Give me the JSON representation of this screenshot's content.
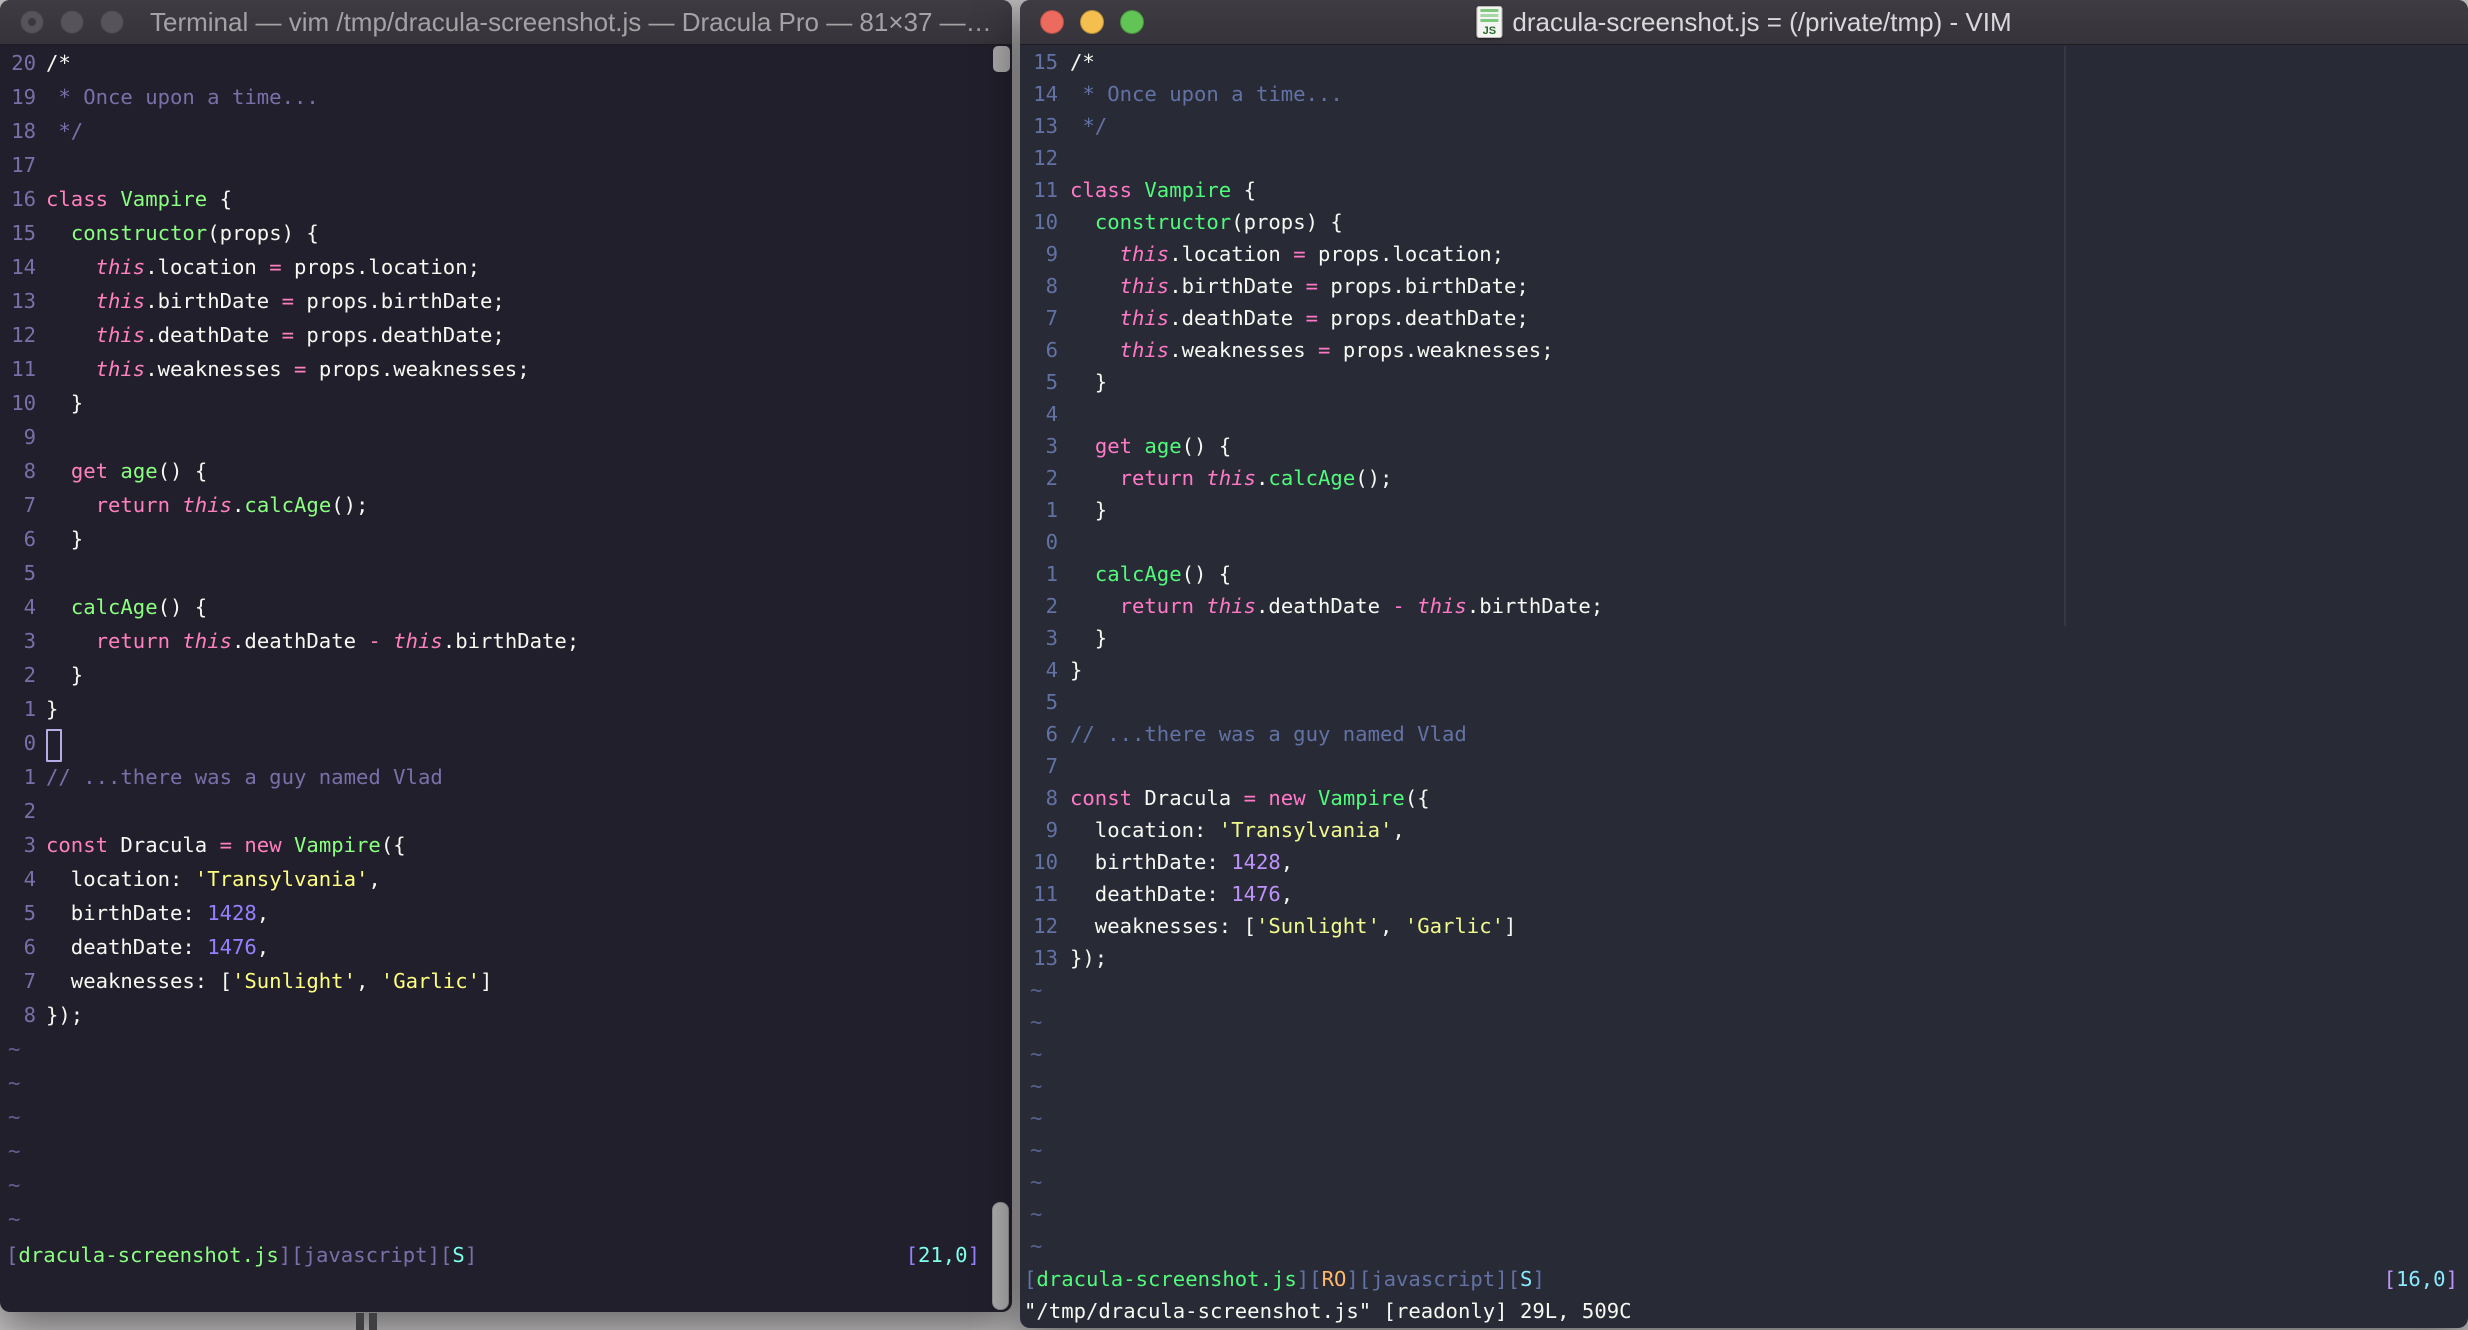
{
  "desktop": {
    "background": "#c6c4c5",
    "behind_window_fragment": "dark glyph fragment"
  },
  "left_window": {
    "app": "Terminal",
    "title": "Terminal — vim /tmp/dracula-screenshot.js — Dracula Pro — 81×37 —…",
    "focused": false,
    "traffic_lights": {
      "inactive_color": "#56535a",
      "close_has_edit_dot": true
    },
    "theme": {
      "bg": "#211f2b",
      "fg": "#f8f8f2",
      "comment": "#7970a9",
      "pink": "#ff80bf",
      "green": "#8aff80",
      "purple": "#9580ff",
      "yellow": "#ffff80",
      "cyan": "#80ffea",
      "orange": "#ffca80",
      "lineno": "#7970a9"
    },
    "rel_numbers": [
      "20",
      "19",
      "18",
      "17",
      "16",
      "15",
      "14",
      "13",
      "12",
      "11",
      "10",
      "9",
      "8",
      "7",
      "6",
      "5",
      "4",
      "3",
      "2",
      "1",
      "0",
      "1",
      "2",
      "3",
      "4",
      "5",
      "6",
      "7",
      "8"
    ],
    "tilde_rows": 6,
    "cursor": {
      "line": 21,
      "col": 0,
      "style": "hollow-block"
    },
    "status": {
      "segments": [
        [
          "comment",
          "["
        ],
        [
          "green",
          "dracula-screenshot.js"
        ],
        [
          "comment",
          "]["
        ],
        [
          "comment",
          "javascript"
        ],
        [
          "comment",
          "]["
        ],
        [
          "cyan",
          "S"
        ],
        [
          "comment",
          "]"
        ]
      ],
      "ruler": [
        [
          "purple",
          "["
        ],
        [
          "cyan",
          "21,0"
        ],
        [
          "purple",
          "]"
        ]
      ]
    },
    "scrollbar": {
      "top_thumb": true,
      "bottom_thumb": true,
      "color": "#a9a7a8"
    }
  },
  "right_window": {
    "app": "MacVim",
    "title": "dracula-screenshot.js = (/private/tmp) - VIM",
    "focused": true,
    "traffic_lights": {
      "close": "#ec6a5e",
      "minimize": "#f5bf4f",
      "zoom": "#61c454"
    },
    "file_icon": "js-document-icon",
    "theme": {
      "bg": "#282a36",
      "fg": "#f8f8f2",
      "comment": "#6272a4",
      "pink": "#ff79c6",
      "green": "#50fa7b",
      "purple": "#bd93f9",
      "yellow": "#f1fa8c",
      "cyan": "#8be9fd",
      "orange": "#ffb86c",
      "lineno": "#6272a4"
    },
    "rel_numbers": [
      "15",
      "14",
      "13",
      "12",
      "11",
      "10",
      "9",
      "8",
      "7",
      "6",
      "5",
      "4",
      "3",
      "2",
      "1",
      "0",
      "1",
      "2",
      "3",
      "4",
      "5",
      "6",
      "7",
      "8",
      "9",
      "10",
      "11",
      "12",
      "13"
    ],
    "tilde_rows": 9,
    "cursor": {
      "line": 16,
      "col": 0,
      "style": "hidden-blink"
    },
    "color_column": 80,
    "status": {
      "segments": [
        [
          "comment",
          "["
        ],
        [
          "green",
          "dracula-screenshot.js"
        ],
        [
          "comment",
          "]["
        ],
        [
          "orange",
          "RO"
        ],
        [
          "comment",
          "]["
        ],
        [
          "comment",
          "javascript"
        ],
        [
          "comment",
          "]["
        ],
        [
          "cyan",
          "S"
        ],
        [
          "comment",
          "]"
        ]
      ],
      "ruler": [
        [
          "purple",
          "["
        ],
        [
          "cyan",
          "16,0"
        ],
        [
          "purple",
          "]"
        ]
      ]
    },
    "message": "\"/tmp/dracula-screenshot.js\" [readonly] 29L, 509C"
  },
  "code_lines": [
    {
      "segments": [
        [
          "fg",
          "/*"
        ]
      ]
    },
    {
      "segments": [
        [
          "comment",
          " * Once upon a time..."
        ]
      ]
    },
    {
      "segments": [
        [
          "comment",
          " */"
        ]
      ]
    },
    {
      "segments": []
    },
    {
      "segments": [
        [
          "pink",
          "class "
        ],
        [
          "green",
          "Vampire"
        ],
        [
          "fg",
          " {"
        ]
      ]
    },
    {
      "segments": [
        [
          "fg",
          "  "
        ],
        [
          "green",
          "constructor"
        ],
        [
          "fg",
          "(props) {"
        ]
      ]
    },
    {
      "segments": [
        [
          "fg",
          "    "
        ],
        [
          "pinki",
          "this"
        ],
        [
          "fg",
          ".location "
        ],
        [
          "pink",
          "="
        ],
        [
          "fg",
          " props.location;"
        ]
      ]
    },
    {
      "segments": [
        [
          "fg",
          "    "
        ],
        [
          "pinki",
          "this"
        ],
        [
          "fg",
          ".birthDate "
        ],
        [
          "pink",
          "="
        ],
        [
          "fg",
          " props.birthDate;"
        ]
      ]
    },
    {
      "segments": [
        [
          "fg",
          "    "
        ],
        [
          "pinki",
          "this"
        ],
        [
          "fg",
          ".deathDate "
        ],
        [
          "pink",
          "="
        ],
        [
          "fg",
          " props.deathDate;"
        ]
      ]
    },
    {
      "segments": [
        [
          "fg",
          "    "
        ],
        [
          "pinki",
          "this"
        ],
        [
          "fg",
          ".weaknesses "
        ],
        [
          "pink",
          "="
        ],
        [
          "fg",
          " props.weaknesses;"
        ]
      ]
    },
    {
      "segments": [
        [
          "fg",
          "  }"
        ]
      ]
    },
    {
      "segments": []
    },
    {
      "segments": [
        [
          "fg",
          "  "
        ],
        [
          "pink",
          "get "
        ],
        [
          "green",
          "age"
        ],
        [
          "fg",
          "() {"
        ]
      ]
    },
    {
      "segments": [
        [
          "fg",
          "    "
        ],
        [
          "pink",
          "return "
        ],
        [
          "pinki",
          "this"
        ],
        [
          "fg",
          "."
        ],
        [
          "green",
          "calcAge"
        ],
        [
          "fg",
          "();"
        ]
      ]
    },
    {
      "segments": [
        [
          "fg",
          "  }"
        ]
      ]
    },
    {
      "segments": []
    },
    {
      "segments": [
        [
          "fg",
          "  "
        ],
        [
          "green",
          "calcAge"
        ],
        [
          "fg",
          "() {"
        ]
      ]
    },
    {
      "segments": [
        [
          "fg",
          "    "
        ],
        [
          "pink",
          "return "
        ],
        [
          "pinki",
          "this"
        ],
        [
          "fg",
          ".deathDate "
        ],
        [
          "pink",
          "-"
        ],
        [
          "fg",
          " "
        ],
        [
          "pinki",
          "this"
        ],
        [
          "fg",
          ".birthDate;"
        ]
      ]
    },
    {
      "segments": [
        [
          "fg",
          "  }"
        ]
      ]
    },
    {
      "segments": [
        [
          "fg",
          "}"
        ]
      ]
    },
    {
      "segments": []
    },
    {
      "segments": [
        [
          "comment",
          "// ...there was a guy named Vlad"
        ]
      ]
    },
    {
      "segments": []
    },
    {
      "segments": [
        [
          "pink",
          "const "
        ],
        [
          "fg",
          "Dracula "
        ],
        [
          "pink",
          "= new "
        ],
        [
          "green",
          "Vampire"
        ],
        [
          "fg",
          "({"
        ]
      ]
    },
    {
      "segments": [
        [
          "fg",
          "  location: "
        ],
        [
          "yellow",
          "'Transylvania'"
        ],
        [
          "fg",
          ","
        ]
      ]
    },
    {
      "segments": [
        [
          "fg",
          "  birthDate: "
        ],
        [
          "purple",
          "1428"
        ],
        [
          "fg",
          ","
        ]
      ]
    },
    {
      "segments": [
        [
          "fg",
          "  deathDate: "
        ],
        [
          "purple",
          "1476"
        ],
        [
          "fg",
          ","
        ]
      ]
    },
    {
      "segments": [
        [
          "fg",
          "  weaknesses: ["
        ],
        [
          "yellow",
          "'Sunlight'"
        ],
        [
          "fg",
          ", "
        ],
        [
          "yellow",
          "'Garlic'"
        ],
        [
          "fg",
          "]"
        ]
      ]
    },
    {
      "segments": [
        [
          "fg",
          "});"
        ]
      ]
    }
  ]
}
